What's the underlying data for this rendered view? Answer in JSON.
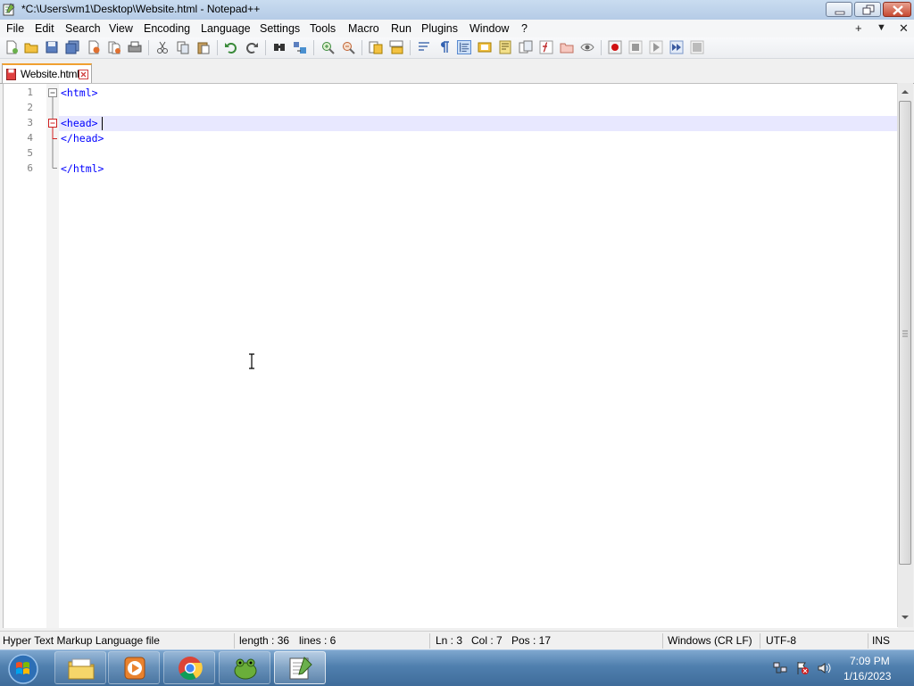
{
  "window": {
    "title": "*C:\\Users\\vm1\\Desktop\\Website.html - Notepad++"
  },
  "menu": {
    "items": [
      "File",
      "Edit",
      "Search",
      "View",
      "Encoding",
      "Language",
      "Settings",
      "Tools",
      "Macro",
      "Run",
      "Plugins",
      "Window",
      "?"
    ],
    "right": [
      "+",
      "▼",
      "✕"
    ]
  },
  "tab": {
    "label": "Website.html"
  },
  "editor": {
    "line_numbers": [
      "1",
      "2",
      "3",
      "4",
      "5",
      "6"
    ],
    "lines": [
      "<html>",
      "",
      "<head>",
      "</head>",
      "",
      "</html>"
    ],
    "current_line_index": 3
  },
  "status": {
    "file_type": "Hyper Text Markup Language file",
    "length": "length : 36",
    "lines": "lines : 6",
    "ln": "Ln : 3",
    "col": "Col : 7",
    "pos": "Pos : 17",
    "eol": "Windows (CR LF)",
    "encoding": "UTF-8",
    "mode": "INS"
  },
  "taskbar": {
    "time": "7:09 PM",
    "date": "1/16/2023"
  },
  "colors": {
    "tag": "#0000ff",
    "current_line": "#e8e8ff",
    "tab_accent": "#f0a030"
  }
}
